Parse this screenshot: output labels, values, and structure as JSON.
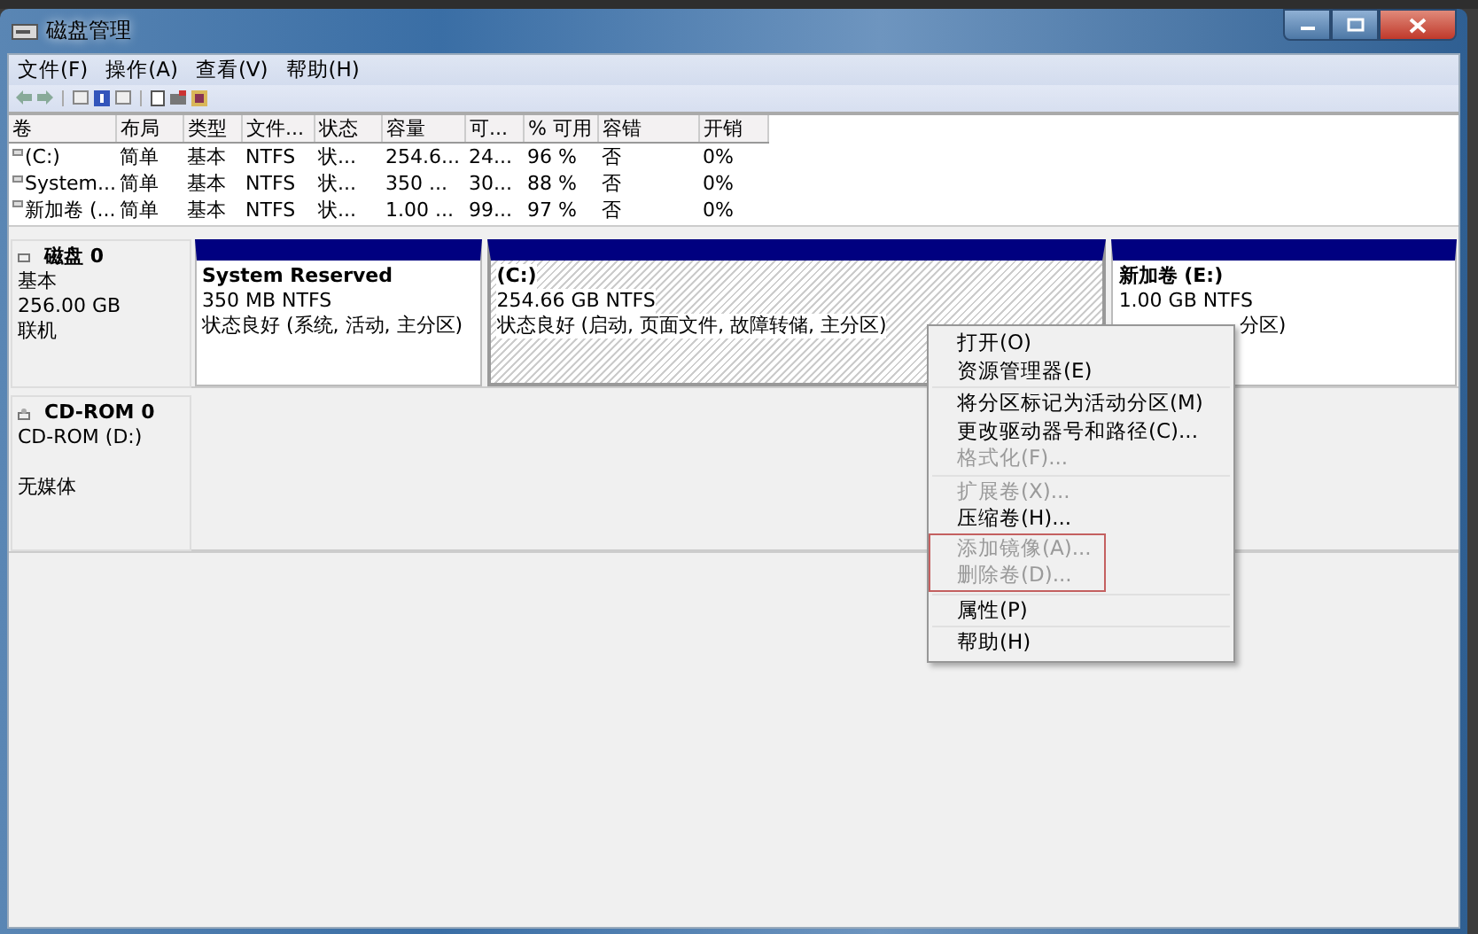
{
  "window": {
    "title": "磁盘管理"
  },
  "menu_bar": [
    "文件(F)",
    "操作(A)",
    "查看(V)",
    "帮助(H)"
  ],
  "volume_table": {
    "columns": [
      "卷",
      "布局",
      "类型",
      "文件...",
      "状态",
      "容量",
      "可...",
      "% 可用",
      "容错",
      "开销"
    ],
    "rows": [
      [
        "(C:)",
        "简单",
        "基本",
        "NTFS",
        "状...",
        "254.6...",
        "24...",
        "96 %",
        "否",
        "0%"
      ],
      [
        "System...",
        "简单",
        "基本",
        "NTFS",
        "状...",
        "350 ...",
        "30...",
        "88 %",
        "否",
        "0%"
      ],
      [
        "新加卷 (...",
        "简单",
        "基本",
        "NTFS",
        "状...",
        "1.00 ...",
        "99...",
        "97 %",
        "否",
        "0%"
      ]
    ]
  },
  "disks": [
    {
      "kind": "disk",
      "name": "磁盘 0",
      "lines": [
        "基本",
        "256.00 GB",
        "联机"
      ],
      "partitions": [
        {
          "name": "System Reserved",
          "size": "350 MB NTFS",
          "status": "状态良好 (系统, 活动, 主分区)",
          "selected": false,
          "covered": false
        },
        {
          "name": "(C:)",
          "size": "254.66 GB NTFS",
          "status": "状态良好 (启动, 页面文件, 故障转储, 主分区)",
          "selected": true,
          "covered": false
        },
        {
          "name": "新加卷  (E:)",
          "size": "1.00 GB NTFS",
          "status": "分区)",
          "selected": false,
          "covered": true
        }
      ]
    },
    {
      "kind": "cdrom",
      "name": "CD-ROM 0",
      "lines": [
        "CD-ROM (D:)",
        "无媒体"
      ]
    }
  ],
  "context_menu": [
    {
      "kind": "item",
      "label": "打开(O)",
      "disabled": false,
      "highlighted": false
    },
    {
      "kind": "item",
      "label": "资源管理器(E)",
      "disabled": false,
      "highlighted": false
    },
    {
      "kind": "separator"
    },
    {
      "kind": "item",
      "label": "将分区标记为活动分区(M)",
      "disabled": false,
      "highlighted": false
    },
    {
      "kind": "item",
      "label": "更改驱动器号和路径(C)...",
      "disabled": false,
      "highlighted": false
    },
    {
      "kind": "item",
      "label": "格式化(F)...",
      "disabled": true,
      "highlighted": false
    },
    {
      "kind": "separator"
    },
    {
      "kind": "item",
      "label": "扩展卷(X)...",
      "disabled": true,
      "highlighted": false
    },
    {
      "kind": "item",
      "label": "压缩卷(H)...",
      "disabled": false,
      "highlighted": false
    },
    {
      "kind": "item",
      "label": "添加镜像(A)...",
      "disabled": true,
      "highlighted": true
    },
    {
      "kind": "item",
      "label": "删除卷(D)...",
      "disabled": true,
      "highlighted": true
    },
    {
      "kind": "separator"
    },
    {
      "kind": "item",
      "label": "属性(P)",
      "disabled": false,
      "highlighted": false
    },
    {
      "kind": "separator"
    },
    {
      "kind": "item",
      "label": "帮助(H)",
      "disabled": false,
      "highlighted": false
    }
  ]
}
